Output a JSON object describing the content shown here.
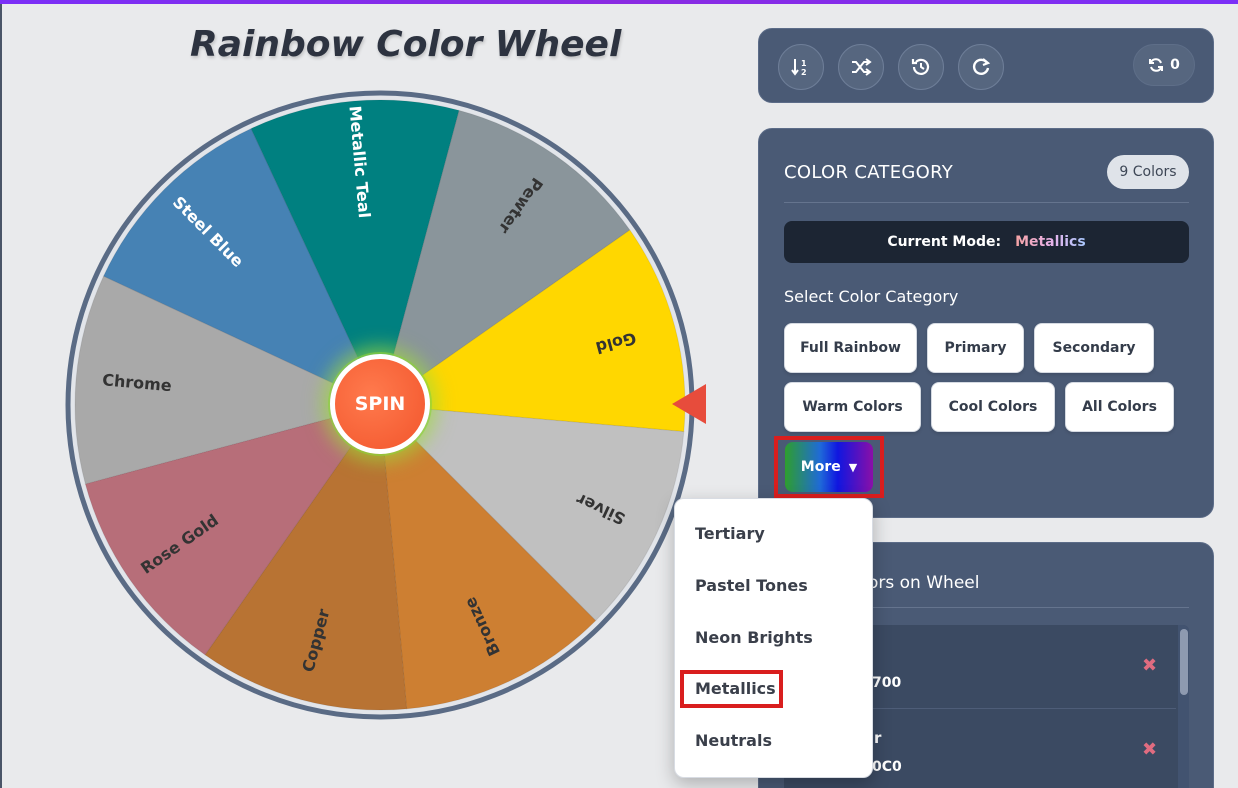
{
  "title": "Rainbow Color Wheel",
  "spin_label": "SPIN",
  "wheel": {
    "segments": [
      {
        "label": "Pewter",
        "color": "#8a959b",
        "text_color": "#333333"
      },
      {
        "label": "Gold",
        "color": "#ffd700",
        "text_color": "#333333"
      },
      {
        "label": "Silver",
        "color": "#c0c0c0",
        "text_color": "#333333"
      },
      {
        "label": "Bronze",
        "color": "#cd7f32",
        "text_color": "#333333"
      },
      {
        "label": "Copper",
        "color": "#b87333",
        "text_color": "#333333"
      },
      {
        "label": "Rose Gold",
        "color": "#b76e79",
        "text_color": "#333333"
      },
      {
        "label": "Chrome",
        "color": "#a9a9a9",
        "text_color": "#333333"
      },
      {
        "label": "Steel Blue",
        "color": "#4682b4",
        "text_color": "#ffffff"
      },
      {
        "label": "Metallic Teal",
        "color": "#008080",
        "text_color": "#ffffff"
      }
    ],
    "rim_color": "#5a6b85",
    "pointer_color": "#e74c3c"
  },
  "toolbar": {
    "sort_icon": "sort-icon",
    "shuffle_icon": "shuffle-icon",
    "history_icon": "history-icon",
    "reset_icon": "reset-icon",
    "spin_count": "0"
  },
  "category": {
    "title": "COLOR CATEGORY",
    "count_badge": "9 Colors",
    "current_mode_label": "Current Mode:",
    "current_mode_value": "Metallics",
    "select_label": "Select Color Category",
    "buttons": [
      "Full Rainbow",
      "Primary",
      "Secondary",
      "Warm Colors",
      "Cool Colors",
      "All Colors"
    ],
    "more_label": "More"
  },
  "dropdown": {
    "items": [
      "Tertiary",
      "Pastel Tones",
      "Neon Brights",
      "Metallics",
      "Neutrals"
    ]
  },
  "colors_on_wheel": {
    "title_visible": "ors on Wheel",
    "rows": [
      {
        "name": "",
        "hex": "700"
      },
      {
        "name": "r",
        "hex": "0C0"
      }
    ]
  }
}
